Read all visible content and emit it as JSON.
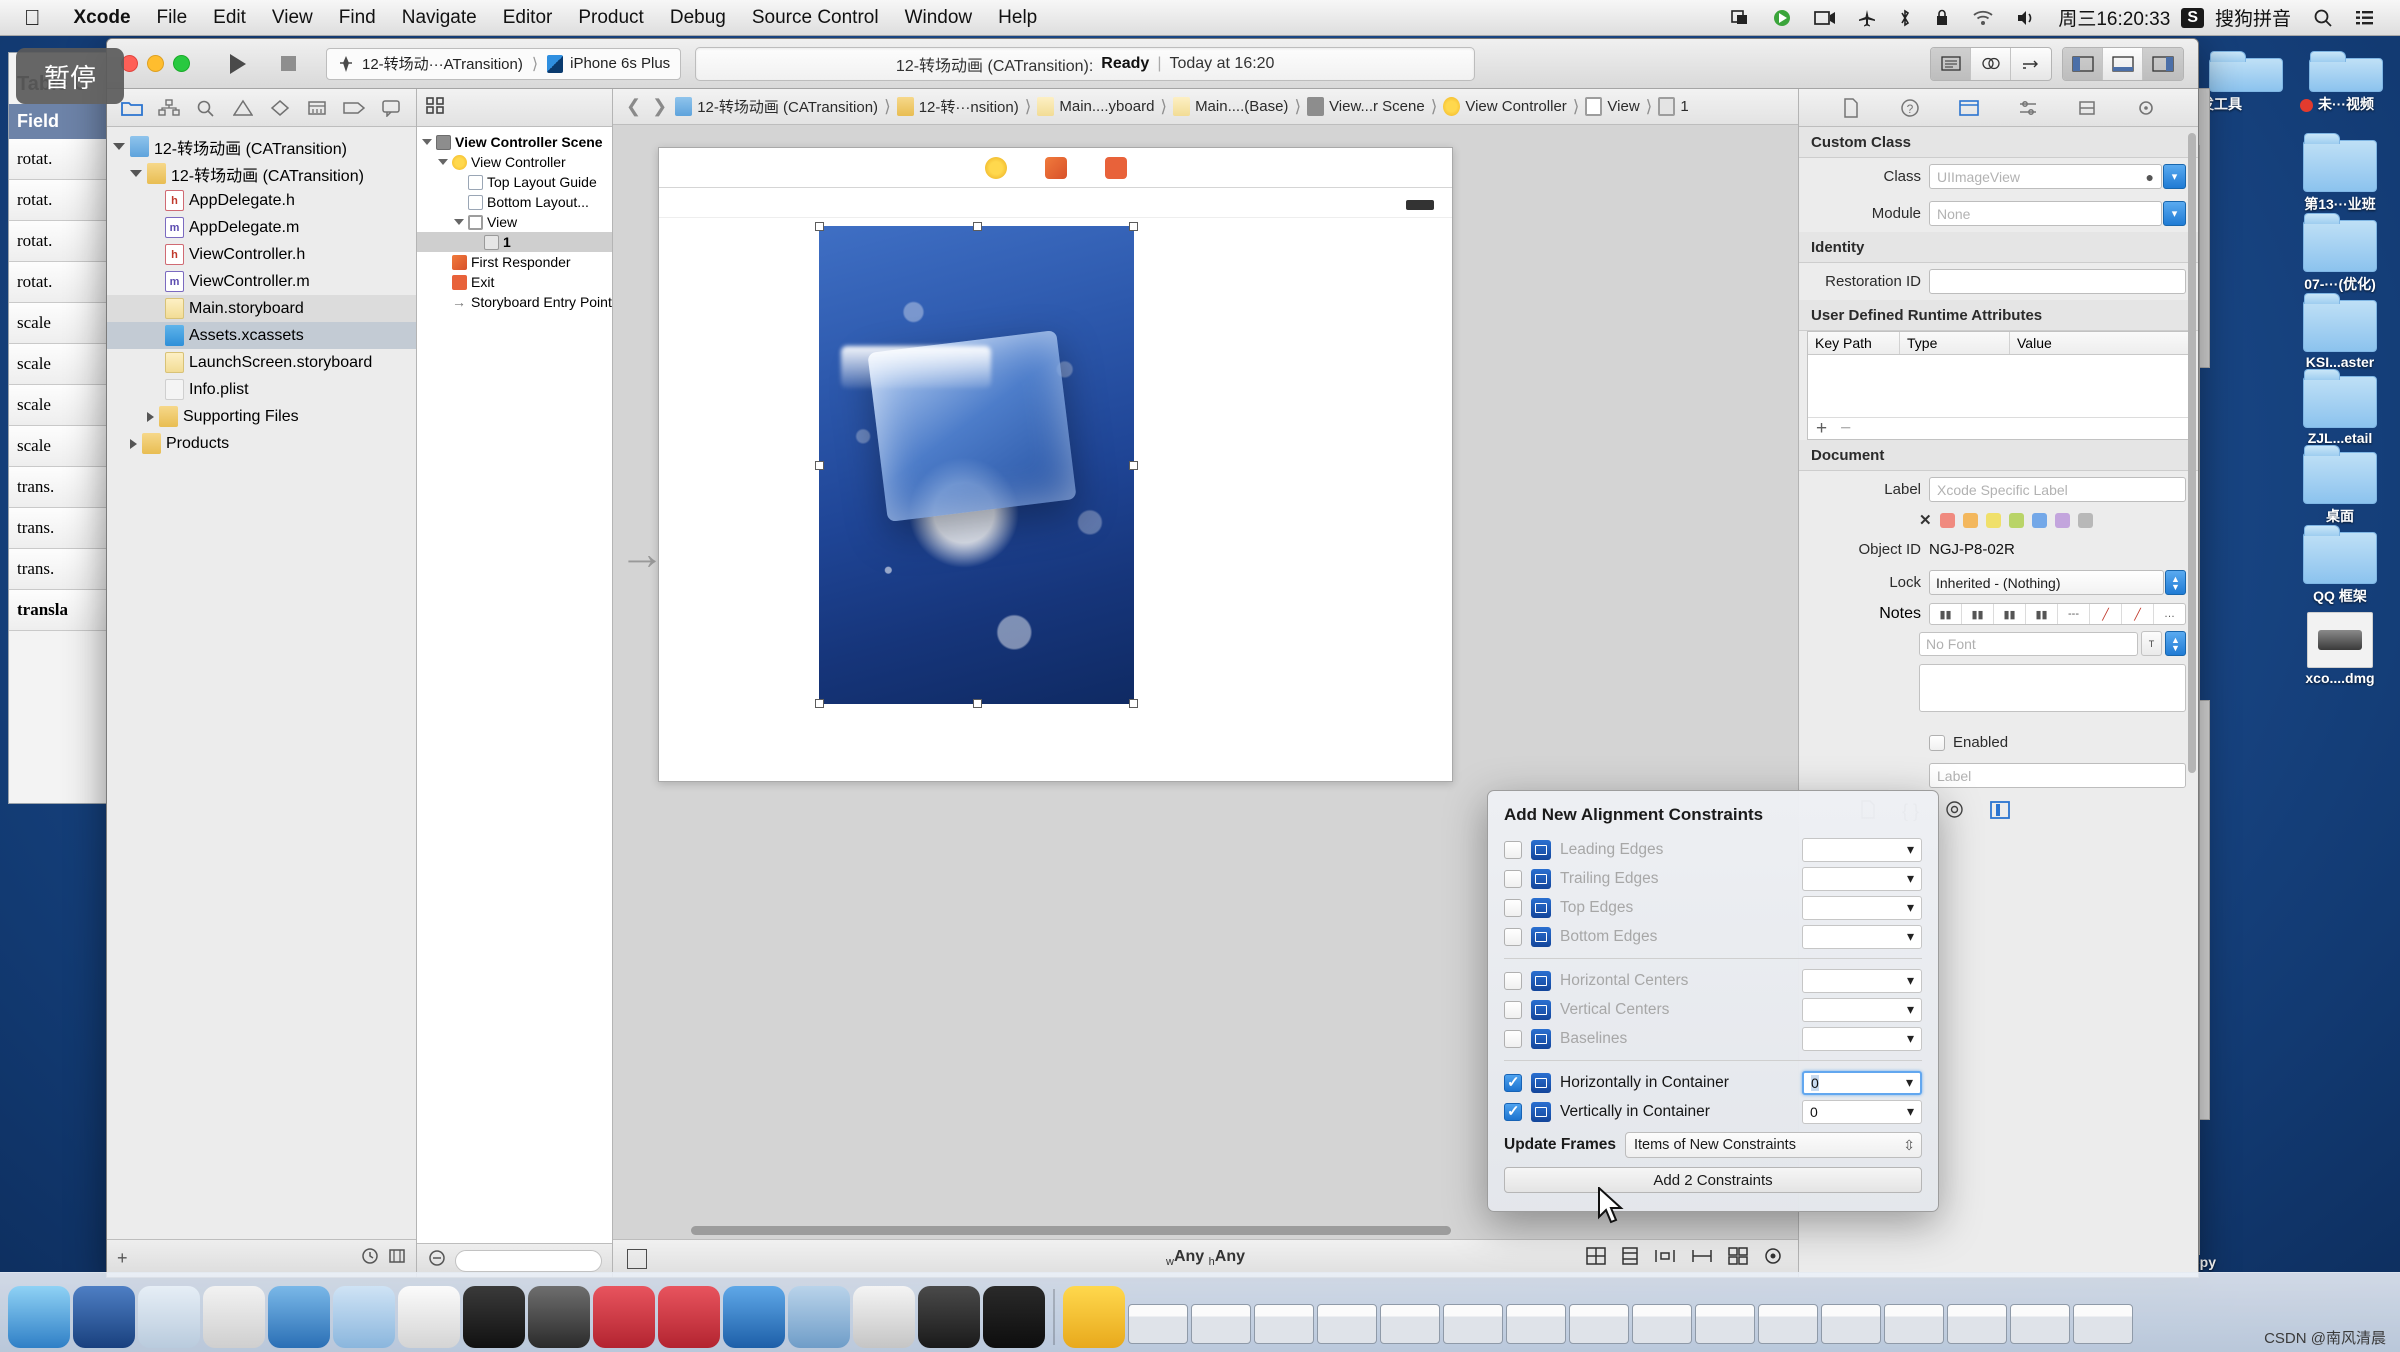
{
  "menubar": {
    "apple_icon": "apple-logo-icon",
    "items": [
      "Xcode",
      "File",
      "Edit",
      "View",
      "Find",
      "Navigate",
      "Editor",
      "Product",
      "Debug",
      "Source Control",
      "Window",
      "Help"
    ],
    "right_icons": [
      "screen-share-icon",
      "quicktime-record-icon",
      "video-camera-icon",
      "airplane-mode-icon",
      "bluetooth-icon",
      "lock-icon",
      "wifi-icon",
      "volume-icon"
    ],
    "clock": "周三16:20:33",
    "input_method_badge": "S",
    "input_method": "搜狗拼音",
    "search_icon": "search-icon",
    "notification_icon": "notification-center-icon"
  },
  "pause_badge": "暂停",
  "toolbar": {
    "scheme_name": "12-转场动···ATransition)",
    "device_name": "iPhone 6s Plus",
    "status_project": "12-转场动画 (CATransition):",
    "status_state": "Ready",
    "status_sep": "|",
    "status_time": "Today at 16:20",
    "editor_segments": [
      "standard-editor-icon",
      "assistant-editor-icon",
      "version-editor-icon"
    ],
    "view_segments": [
      "hide-navigator-icon",
      "hide-debug-icon",
      "hide-utilities-icon"
    ]
  },
  "navigator": {
    "tabs": [
      "project-navigator-icon",
      "symbol-navigator-icon",
      "find-navigator-icon",
      "issue-navigator-icon",
      "test-navigator-icon",
      "debug-navigator-icon",
      "breakpoint-navigator-icon",
      "report-navigator-icon"
    ],
    "items": [
      {
        "label": "12-转场动画 (CATransition)",
        "kind": "proj",
        "indent": 0,
        "state": "open"
      },
      {
        "label": "12-转场动画 (CATransition)",
        "kind": "fold",
        "indent": 1,
        "state": "open"
      },
      {
        "label": "AppDelegate.h",
        "kind": "h",
        "indent": 2,
        "state": ""
      },
      {
        "label": "AppDelegate.m",
        "kind": "m",
        "indent": 2,
        "state": ""
      },
      {
        "label": "ViewController.h",
        "kind": "h",
        "indent": 2,
        "state": ""
      },
      {
        "label": "ViewController.m",
        "kind": "m",
        "indent": 2,
        "state": ""
      },
      {
        "label": "Main.storyboard",
        "kind": "sb",
        "indent": 2,
        "state": "hl"
      },
      {
        "label": "Assets.xcassets",
        "kind": "xca",
        "indent": 2,
        "state": "sel"
      },
      {
        "label": "LaunchScreen.storyboard",
        "kind": "sb",
        "indent": 2,
        "state": ""
      },
      {
        "label": "Info.plist",
        "kind": "plist",
        "indent": 2,
        "state": ""
      },
      {
        "label": "Supporting Files",
        "kind": "fold",
        "indent": 2,
        "state": "closed"
      },
      {
        "label": "Products",
        "kind": "fold",
        "indent": 1,
        "state": "closed"
      }
    ],
    "footer_add": "+",
    "footer_icons": [
      "recent-files-icon",
      "source-control-filter-icon"
    ]
  },
  "outline": {
    "items": [
      {
        "label": "View Controller Scene",
        "icon": "scene",
        "indent": 0,
        "arrow": true,
        "bold": true
      },
      {
        "label": "View Controller",
        "icon": "vc",
        "indent": 1,
        "arrow": true,
        "bold": false
      },
      {
        "label": "Top Layout Guide",
        "icon": "guide",
        "indent": 2,
        "arrow": false,
        "bold": false
      },
      {
        "label": "Bottom Layout...",
        "icon": "guide",
        "indent": 2,
        "arrow": false,
        "bold": false
      },
      {
        "label": "View",
        "icon": "view",
        "indent": 2,
        "arrow": true,
        "bold": false
      },
      {
        "label": "1",
        "icon": "img",
        "indent": 3,
        "arrow": false,
        "bold": true,
        "selected": true
      },
      {
        "label": "First Responder",
        "icon": "fr",
        "indent": 1,
        "arrow": false,
        "bold": false
      },
      {
        "label": "Exit",
        "icon": "exit",
        "indent": 1,
        "arrow": false,
        "bold": false
      },
      {
        "label": "Storyboard Entry Point",
        "icon": "entry",
        "indent": 1,
        "arrow": false,
        "bold": false
      }
    ]
  },
  "jumpbar": {
    "back_icon": "chevron-left-icon",
    "forward_icon": "chevron-right-icon",
    "crumbs": [
      {
        "label": "12-转场动画 (CATransition)",
        "icon": "project-icon"
      },
      {
        "label": "12-转···nsition)",
        "icon": "folder-icon"
      },
      {
        "label": "Main....yboard",
        "icon": "storyboard-icon"
      },
      {
        "label": "Main....(Base)",
        "icon": "storyboard-icon"
      },
      {
        "label": "View...r Scene",
        "icon": "scene-icon"
      },
      {
        "label": "View Controller",
        "icon": "view-controller-icon"
      },
      {
        "label": "View",
        "icon": "view-icon"
      },
      {
        "label": "1",
        "icon": "image-view-icon"
      }
    ]
  },
  "canvas": {
    "device_toolbar_icons": [
      "view-controller-badge-icon",
      "first-responder-badge-icon",
      "exit-badge-icon"
    ],
    "entry_arrow": "storyboard-entry-arrow-icon",
    "selected_view": "image-view-1"
  },
  "editbar": {
    "device_toggle_icon": "device-preview-icon",
    "size_class": "wAny hAny",
    "w_prefix": "w",
    "h_prefix": "h",
    "right_icons": [
      "align-icon",
      "pin-icon",
      "resolve-auto-layout-icon",
      "resize-behaviour-icon",
      "zoom-icon",
      "snapshot-icon"
    ]
  },
  "inspector": {
    "tabs": [
      "file-inspector-icon",
      "quick-help-icon",
      "identity-inspector-icon",
      "attributes-inspector-icon",
      "size-inspector-icon",
      "connections-inspector-icon"
    ],
    "custom_class": {
      "header": "Custom Class",
      "class_label": "Class",
      "class_value": "UIImageView",
      "module_label": "Module",
      "module_value": "None"
    },
    "identity": {
      "header": "Identity",
      "restoration_label": "Restoration ID",
      "restoration_value": ""
    },
    "runtime": {
      "header": "User Defined Runtime Attributes",
      "columns": [
        "Key Path",
        "Type",
        "Value"
      ],
      "rows": [],
      "add_btn": "+",
      "remove_btn": "−"
    },
    "document": {
      "header": "Document",
      "label_label": "Label",
      "label_placeholder": "Xcode Specific Label",
      "swatch_none": "✕",
      "swatches": [
        "#f08a7f",
        "#f3b75d",
        "#f0e06a",
        "#b9d468",
        "#74a8e8",
        "#c3a5dd",
        "#b8b8b8"
      ],
      "object_id_label": "Object ID",
      "object_id_value": "NGJ-P8-02R",
      "lock_label": "Lock",
      "lock_value": "Inherited - (Nothing)",
      "notes_label": "Notes",
      "font_placeholder": "No Font"
    },
    "attributes_peek": {
      "enabled_label": "Enabled",
      "label_placeholder": "Label"
    }
  },
  "popover": {
    "title": "Add New Alignment Constraints",
    "rows": [
      {
        "label": "Leading Edges",
        "checked": false,
        "value": "",
        "icon": "leading-edges-icon"
      },
      {
        "label": "Trailing Edges",
        "checked": false,
        "value": "",
        "icon": "trailing-edges-icon"
      },
      {
        "label": "Top Edges",
        "checked": false,
        "value": "",
        "icon": "top-edges-icon"
      },
      {
        "label": "Bottom Edges",
        "checked": false,
        "value": "",
        "icon": "bottom-edges-icon"
      },
      {
        "label": "Horizontal Centers",
        "checked": false,
        "value": "",
        "icon": "horizontal-centers-icon"
      },
      {
        "label": "Vertical Centers",
        "checked": false,
        "value": "",
        "icon": "vertical-centers-icon"
      },
      {
        "label": "Baselines",
        "checked": false,
        "value": "",
        "icon": "baselines-icon"
      },
      {
        "label": "Horizontally in Container",
        "checked": true,
        "value": "0",
        "icon": "horizontally-in-container-icon",
        "focused": true
      },
      {
        "label": "Vertically in Container",
        "checked": true,
        "value": "0",
        "icon": "vertically-in-container-icon"
      }
    ],
    "update_frames_label": "Update Frames",
    "update_frames_value": "Items of New Constraints",
    "add_button": "Add 2 Constraints"
  },
  "background_window": {
    "header": "Table C",
    "selected_row": "Field",
    "rows": [
      "rotat.",
      "rotat.",
      "rotat.",
      "rotat.",
      "scale",
      "scale",
      "scale",
      "scale",
      "trans.",
      "trans.",
      "trans.",
      "transla"
    ]
  },
  "desktop_icons": [
    {
      "label": "发工具",
      "kind": "folder"
    },
    {
      "label": "未···视频",
      "kind": "folder",
      "rec": true
    },
    {
      "label": "第13···业班",
      "kind": "folder"
    },
    {
      "label": "07-···(优化)",
      "kind": "folder"
    },
    {
      "label": "KSI...aster",
      "kind": "folder"
    },
    {
      "label": "ZJL...etail",
      "kind": "folder"
    },
    {
      "label": "桌面",
      "kind": "folder"
    },
    {
      "label": "QQ 框架",
      "kind": "folder"
    },
    {
      "label": "xco....dmg",
      "kind": "dmg"
    },
    {
      "label": "opy",
      "kind": "partial"
    }
  ],
  "watermark": "CSDN @南风清晨"
}
